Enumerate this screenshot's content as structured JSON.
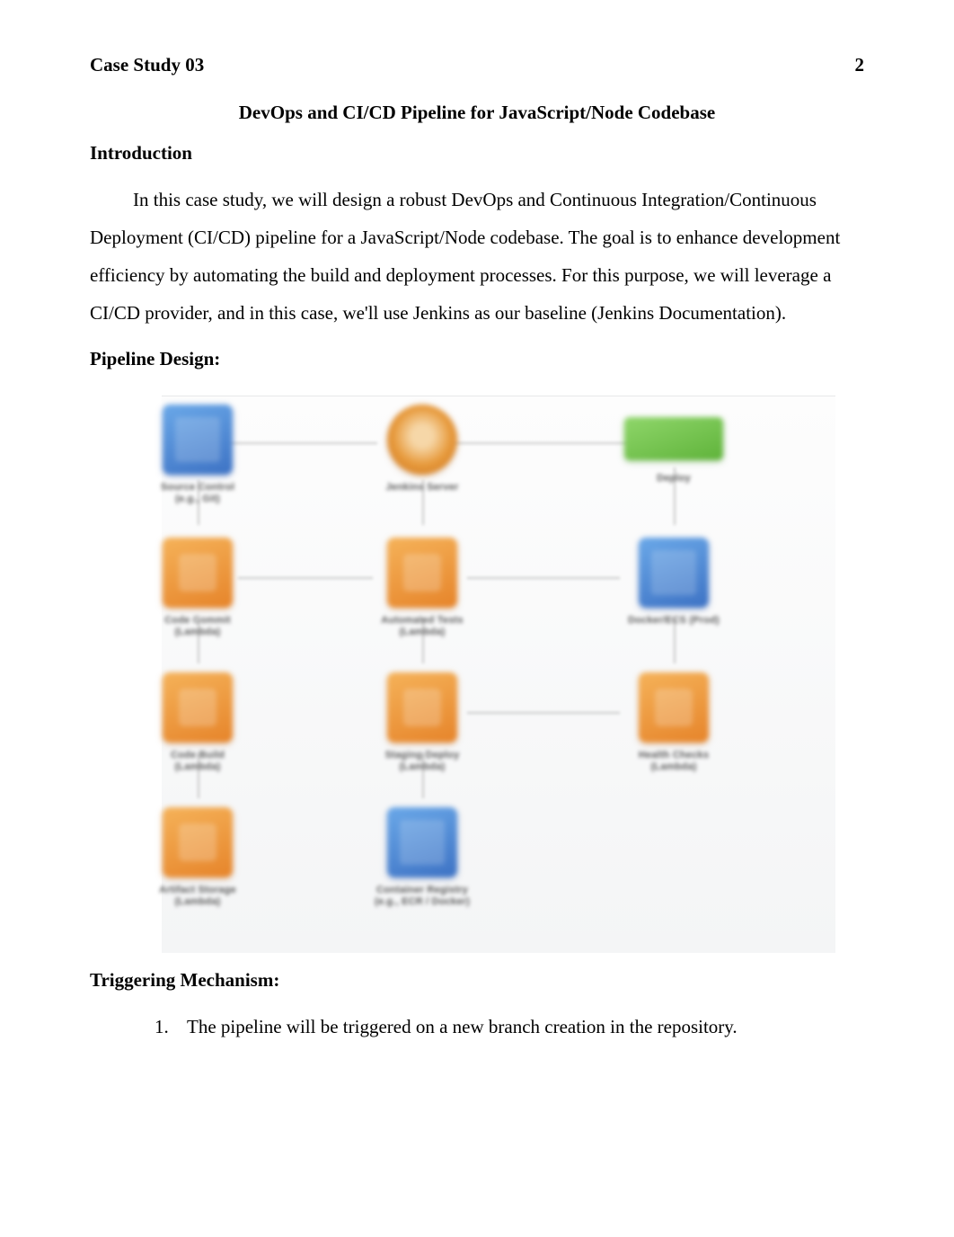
{
  "header": {
    "left": "Case Study 03",
    "page_number": "2"
  },
  "title": "DevOps and CI/CD Pipeline for JavaScript/Node Codebase",
  "sections": {
    "introduction": {
      "heading": "Introduction",
      "paragraph": "In this case study, we will design a robust DevOps and Continuous Integration/Continuous Deployment (CI/CD) pipeline for a JavaScript/Node codebase. The goal is to enhance development efficiency by automating the build and deployment processes. For this purpose, we will leverage a CI/CD provider, and in this case, we'll use Jenkins as our baseline (Jenkins Documentation)."
    },
    "pipeline_design": {
      "heading": "Pipeline Design:"
    },
    "triggering": {
      "heading": "Triggering Mechanism:",
      "items": [
        {
          "num": "1.",
          "text": "The pipeline will be triggered on a new branch creation in the repository."
        }
      ]
    }
  },
  "diagram": {
    "nodes": {
      "r1c1": "Source Control (e.g., Git)",
      "r1c2": "Jenkins Server",
      "r1c3": "Deploy",
      "r2c1": "Code Commit (Lambda)",
      "r2c2": "Automated Tests (Lambda)",
      "r2c3": "Docker/ECS (Prod)",
      "r3c1": "Code Build (Lambda)",
      "r3c2": "Staging Deploy (Lambda)",
      "r3c3": "Health Checks (Lambda)",
      "r4c1": "Artifact Storage (Lambda)",
      "r4c2": "Container Registry (e.g., ECR / Docker)"
    }
  }
}
